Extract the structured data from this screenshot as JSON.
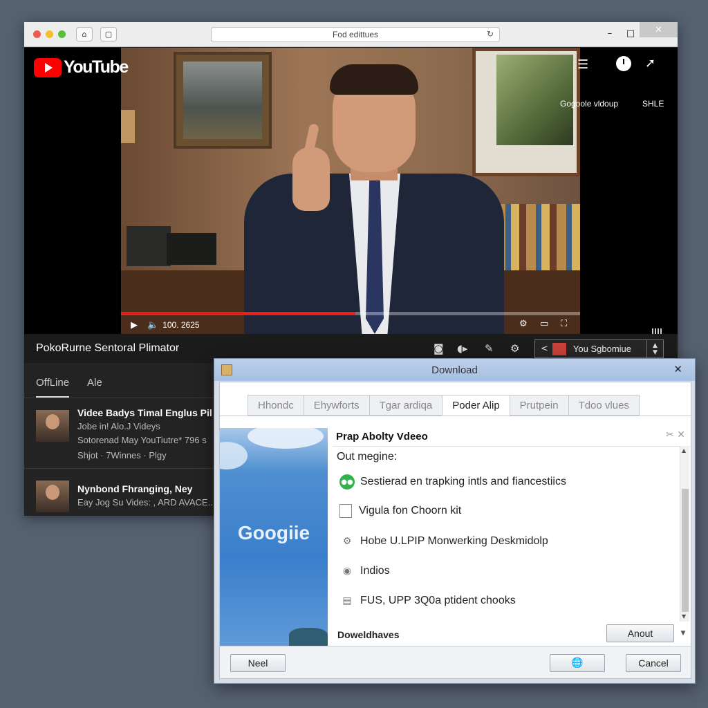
{
  "browser": {
    "address": "Fod edittues",
    "reload_icon": "reload-icon",
    "window_controls": {
      "minimize": "–",
      "maximize": "□",
      "close": "✕"
    }
  },
  "player": {
    "brand": "YouTube",
    "top_actions": [
      {
        "icon": "list-icon",
        "label": "Gogoole vldoup"
      },
      {
        "icon": "clock-icon",
        "label": ""
      },
      {
        "icon": "share-icon",
        "label": "SHLE"
      }
    ],
    "time": "100. 2625",
    "progress": 0.51
  },
  "infobar": {
    "title": "PokoRurne Sentoral Plimator",
    "subscribe_label": "You Sgbomiue"
  },
  "sidebar": {
    "tabs": [
      "OffLine",
      "Ale"
    ],
    "items": [
      {
        "title": "Videe Badys Timal Englus Pil",
        "lines": [
          "Jobe in! Alo.J Videys",
          "Sotorenad May YouTiutre* 796 s",
          "Shjot  ·  7Winnes  ·  Plgy"
        ]
      },
      {
        "title": "Nynbond Fhranging, Ney",
        "lines": [
          "Eay Jog Su Vides: , ARD AVACE.."
        ]
      }
    ]
  },
  "dialog": {
    "title": "Download",
    "tabs": [
      "Hhondc",
      "Ehywforts",
      "Tgar ardiqa",
      "Poder Alip",
      "Prutpein",
      "Tdoo vlues"
    ],
    "active_tab": 3,
    "sidebar_brand": "Googiie",
    "heading": "Prap Abolty Vdeeo",
    "subheading": "Out megine:",
    "options": [
      {
        "icon": "green-status-icon",
        "label": "Sestierad en trapking intls and fiancestiics"
      },
      {
        "icon": "checkbox-icon",
        "label": "Vigula fon Choorn kit"
      },
      {
        "icon": "gear-icon",
        "label": "Hobe U.LPIP Monwerking Deskmidolp"
      },
      {
        "icon": "globe-icon",
        "label": "Indios"
      },
      {
        "icon": "document-icon",
        "label": "FUS, UPP 3Q0a ptident chooks"
      }
    ],
    "downloads_label": "Doweldhaves",
    "about_button": "Anout",
    "next_button": "Neel",
    "cancel_button": "Cancel"
  }
}
